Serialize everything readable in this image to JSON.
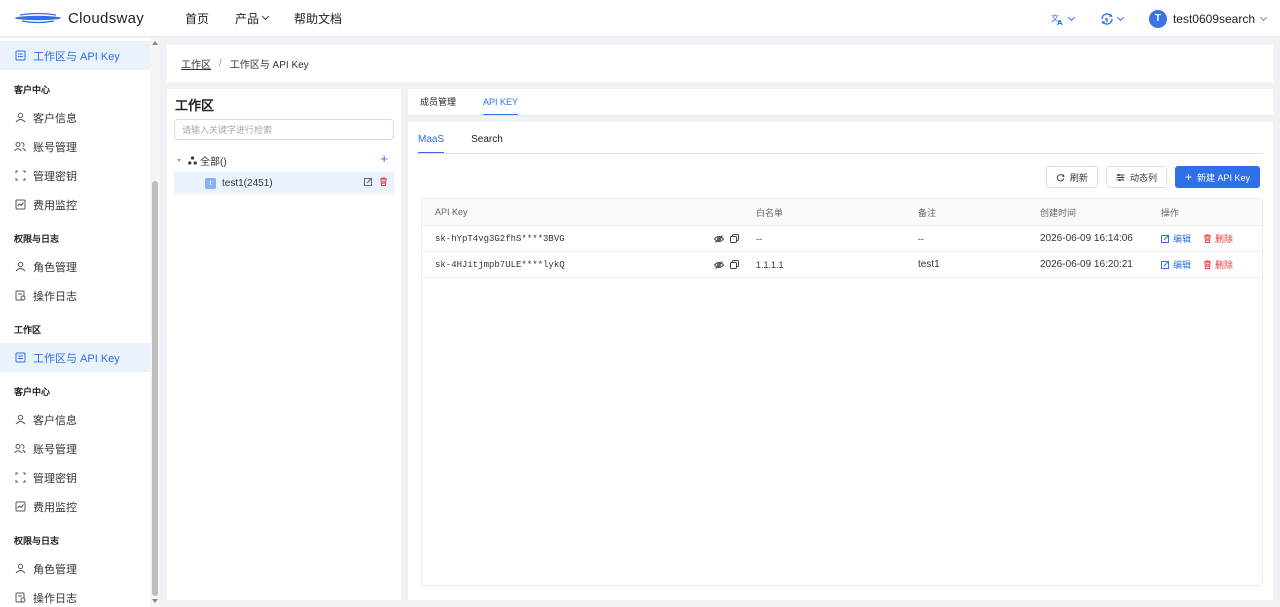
{
  "header": {
    "logo_text": "Cloudsway",
    "nav": [
      {
        "label": "首页"
      },
      {
        "label": "产品"
      },
      {
        "label": "帮助文档"
      }
    ],
    "user": {
      "avatar_letter": "T",
      "name": "test0609search"
    }
  },
  "sidebar": {
    "active_top": "工作区与 API Key",
    "groups": [
      {
        "title": "客户中心",
        "items": [
          "客户信息",
          "账号管理",
          "管理密钥",
          "费用监控"
        ]
      },
      {
        "title": "权限与日志",
        "items": [
          "角色管理",
          "操作日志"
        ]
      },
      {
        "title": "工作区",
        "items": [
          "工作区与 API Key"
        ]
      },
      {
        "title": "客户中心",
        "items": [
          "客户信息",
          "账号管理",
          "管理密钥",
          "费用监控"
        ]
      },
      {
        "title": "权限与日志",
        "items": [
          "角色管理",
          "操作日志"
        ]
      }
    ]
  },
  "breadcrumb": {
    "root": "工作区",
    "separator": "/",
    "current": "工作区与 API Key"
  },
  "workspace": {
    "title": "工作区",
    "search_placeholder": "请输入关键字进行检索",
    "root_label": "全部()",
    "child": {
      "badge": "t",
      "label": "test1(2451)"
    }
  },
  "tabs": [
    {
      "label": "成员管理",
      "active": false
    },
    {
      "label": "API KEY",
      "active": true
    }
  ],
  "subtabs": [
    {
      "label": "MaaS",
      "active": true
    },
    {
      "label": "Search",
      "active": false
    }
  ],
  "toolbar": {
    "refresh": "刷新",
    "columns": "动态列",
    "new_key": "新建 API Key"
  },
  "table": {
    "columns": [
      "API Key",
      "白名单",
      "备注",
      "创建时间",
      "操作"
    ],
    "rows": [
      {
        "key": "sk-hYpT4vg3G2fhS****3BVG",
        "whitelist": "--",
        "note": "--",
        "created": "2026-06-09 16:14:06"
      },
      {
        "key": "sk-4HJitjmpb7ULE****lykQ",
        "whitelist": "1.1.1.1",
        "note": "test1",
        "created": "2026-06-09 16:20:21"
      }
    ],
    "actions": {
      "edit": "编辑",
      "delete": "删除"
    }
  },
  "colors": {
    "accent": "#2f6fe8",
    "danger": "#e04040",
    "active_bg": "#e9f2fd"
  }
}
